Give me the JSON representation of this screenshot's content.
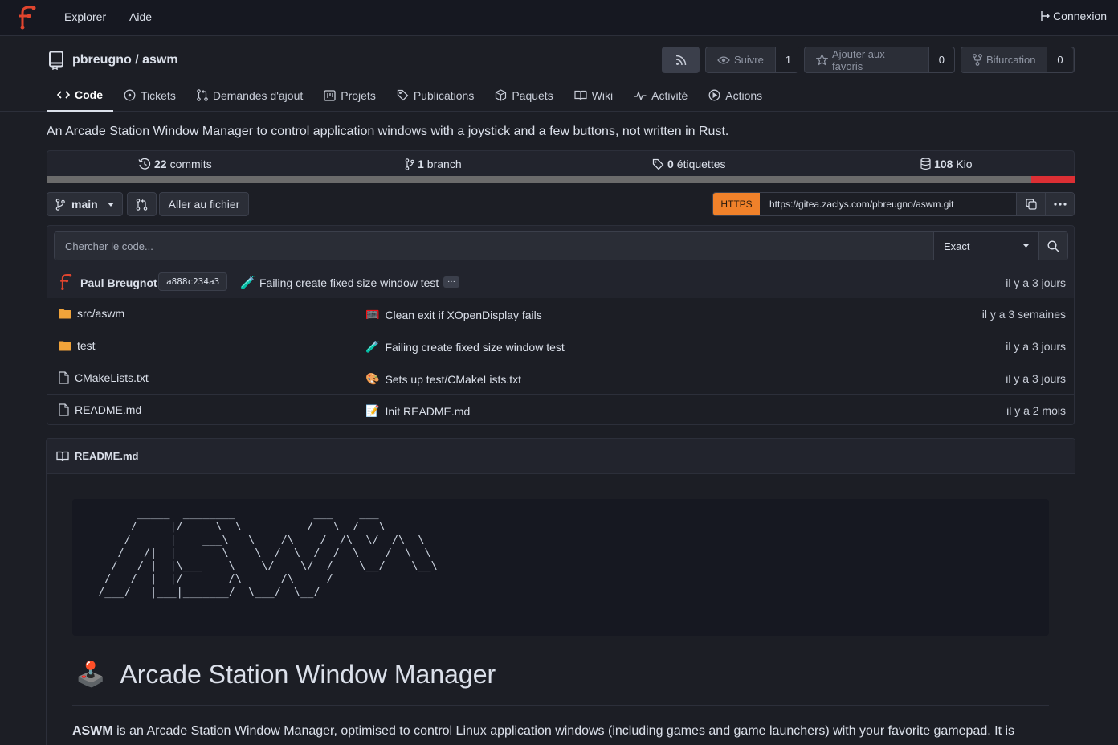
{
  "nav": {
    "explore": "Explorer",
    "help": "Aide",
    "login": "Connexion"
  },
  "repo": {
    "title": "pbreugno / aswm",
    "rss_icon": "rss-icon",
    "watch": {
      "label": "Suivre",
      "count": "1"
    },
    "star": {
      "label": "Ajouter aux favoris",
      "count": "0"
    },
    "fork": {
      "label": "Bifurcation",
      "count": "0"
    },
    "tabs": [
      {
        "label": "Code",
        "icon": "code-icon"
      },
      {
        "label": "Tickets",
        "icon": "issue-icon"
      },
      {
        "label": "Demandes d'ajout",
        "icon": "pull-request-icon"
      },
      {
        "label": "Projets",
        "icon": "project-icon"
      },
      {
        "label": "Publications",
        "icon": "tag-icon"
      },
      {
        "label": "Paquets",
        "icon": "package-icon"
      },
      {
        "label": "Wiki",
        "icon": "book-icon"
      },
      {
        "label": "Activité",
        "icon": "pulse-icon"
      },
      {
        "label": "Actions",
        "icon": "play-icon"
      }
    ],
    "description": "An Arcade Station Window Manager to control application windows with a joystick and a few buttons, not written in Rust."
  },
  "stats": {
    "commits_count": "22",
    "commits_label": "commits",
    "branch_count": "1",
    "branch_label": "branch",
    "tags_count": "0",
    "tags_label": "étiquettes",
    "size_value": "108",
    "size_unit": "Kio"
  },
  "language_colors": [
    "#6b6b6b",
    "#dc2f34"
  ],
  "language_share": [
    0.958,
    0.042
  ],
  "branch": {
    "name": "main",
    "goto_file": "Aller au fichier"
  },
  "clone": {
    "protocol": "HTTPS",
    "url": "https://gitea.zaclys.com/pbreugno/aswm.git",
    "accent": "#f0812a"
  },
  "search": {
    "placeholder": "Chercher le code...",
    "mode": "Exact"
  },
  "latest_commit": {
    "author": "Paul Breugnot",
    "sha": "a888c234a3",
    "emoji": "🧪",
    "message": "Failing create fixed size window test",
    "more": "···",
    "time": "il y a 3 jours"
  },
  "files": [
    {
      "name": "src/aswm",
      "type": "folder",
      "emoji": "🥅",
      "message": "Clean exit if XOpenDisplay fails",
      "time": "il y a 3 semaines"
    },
    {
      "name": "test",
      "type": "folder",
      "emoji": "🧪",
      "message": "Failing create fixed size window test",
      "time": "il y a 3 jours"
    },
    {
      "name": "CMakeLists.txt",
      "type": "file",
      "emoji": "🎨",
      "message": "Sets up test/CMakeLists.txt",
      "time": "il y a 3 jours"
    },
    {
      "name": "README.md",
      "type": "file",
      "emoji": "📝",
      "message": "Init README.md",
      "time": "il y a 2 mois"
    }
  ],
  "readme": {
    "filename": "README.md",
    "ascii_art": "       _____  ________            ___    ___\n      /     |/     \\  \\          /   \\  /   \\\n     /      |    ___\\   \\    /\\    /  /\\  \\/  /\\  \\\n    /   /|  |       \\    \\  /  \\  /  /  \\    /  \\  \\\n   /   / |  |\\___    \\    \\/    \\/  /    \\__/    \\__\\\n  /   /  |  |/       /\\      /\\     /\n /___/   |___|_______/  \\___/  \\__/",
    "heading_emoji": "🕹️",
    "heading": "Arcade Station Window Manager",
    "para_bold": "ASWM",
    "para_text": " is an Arcade Station Window Manager, optimised to control Linux application windows (including games and game launchers) with your favorite gamepad. It is"
  }
}
